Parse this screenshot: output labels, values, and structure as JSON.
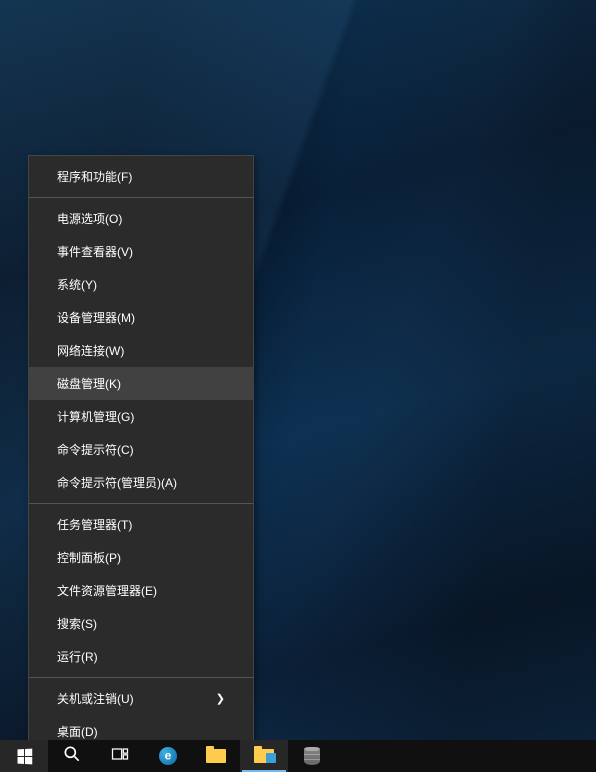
{
  "context_menu": {
    "groups": [
      [
        {
          "id": "programs-features",
          "label": "程序和功能(F)"
        }
      ],
      [
        {
          "id": "power-options",
          "label": "电源选项(O)"
        },
        {
          "id": "event-viewer",
          "label": "事件查看器(V)"
        },
        {
          "id": "system",
          "label": "系统(Y)"
        },
        {
          "id": "device-manager",
          "label": "设备管理器(M)"
        },
        {
          "id": "network-connections",
          "label": "网络连接(W)"
        },
        {
          "id": "disk-management",
          "label": "磁盘管理(K)",
          "highlighted": true
        },
        {
          "id": "computer-management",
          "label": "计算机管理(G)"
        },
        {
          "id": "command-prompt",
          "label": "命令提示符(C)"
        },
        {
          "id": "command-prompt-admin",
          "label": "命令提示符(管理员)(A)"
        }
      ],
      [
        {
          "id": "task-manager",
          "label": "任务管理器(T)"
        },
        {
          "id": "control-panel",
          "label": "控制面板(P)"
        },
        {
          "id": "file-explorer",
          "label": "文件资源管理器(E)"
        },
        {
          "id": "search",
          "label": "搜索(S)"
        },
        {
          "id": "run",
          "label": "运行(R)"
        }
      ],
      [
        {
          "id": "shutdown-signout",
          "label": "关机或注销(U)",
          "submenu": true
        },
        {
          "id": "desktop",
          "label": "桌面(D)"
        }
      ]
    ]
  },
  "taskbar": {
    "items": [
      {
        "id": "start",
        "icon": "windows-logo"
      },
      {
        "id": "search",
        "icon": "search-icon"
      },
      {
        "id": "task-view",
        "icon": "taskview-icon"
      },
      {
        "id": "edge",
        "icon": "edge-icon"
      },
      {
        "id": "file-explorer",
        "icon": "explorer-icon"
      },
      {
        "id": "services",
        "icon": "services-icon",
        "active": true
      },
      {
        "id": "database-app",
        "icon": "db-icon"
      }
    ]
  }
}
